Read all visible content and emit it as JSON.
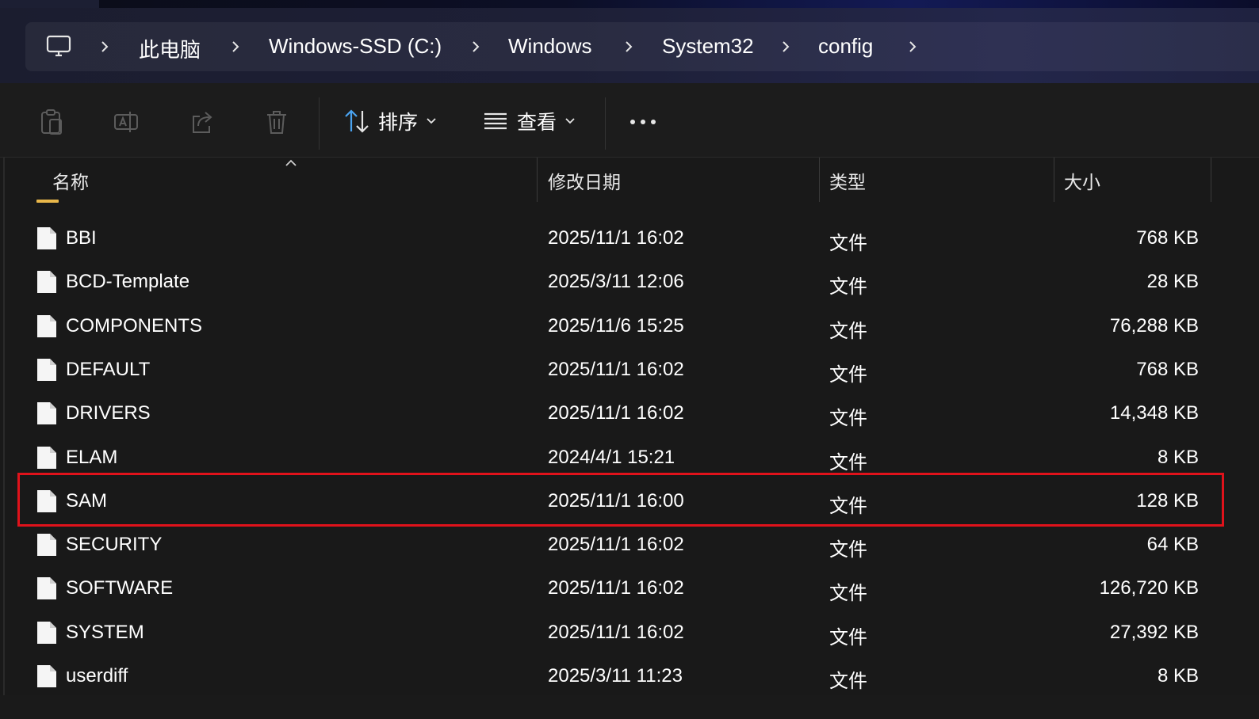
{
  "breadcrumb": {
    "items": [
      "此电脑",
      "Windows-SSD (C:)",
      "Windows",
      "System32",
      "config"
    ]
  },
  "toolbar": {
    "sort_label": "排序",
    "view_label": "查看",
    "icons": [
      "paste-icon",
      "rename-icon",
      "share-icon",
      "delete-icon",
      "sort-icon",
      "view-icon",
      "more-icon"
    ]
  },
  "columns": {
    "name": "名称",
    "date": "修改日期",
    "type": "类型",
    "size": "大小"
  },
  "files": [
    {
      "name": "BBI",
      "date": "2025/11/1 16:02",
      "type": "文件",
      "size": "768 KB"
    },
    {
      "name": "BCD-Template",
      "date": "2025/3/11 12:06",
      "type": "文件",
      "size": "28 KB"
    },
    {
      "name": "COMPONENTS",
      "date": "2025/11/6 15:25",
      "type": "文件",
      "size": "76,288 KB"
    },
    {
      "name": "DEFAULT",
      "date": "2025/11/1 16:02",
      "type": "文件",
      "size": "768 KB"
    },
    {
      "name": "DRIVERS",
      "date": "2025/11/1 16:02",
      "type": "文件",
      "size": "14,348 KB"
    },
    {
      "name": "ELAM",
      "date": "2024/4/1 15:21",
      "type": "文件",
      "size": "8 KB"
    },
    {
      "name": "SAM",
      "date": "2025/11/1 16:00",
      "type": "文件",
      "size": "128 KB"
    },
    {
      "name": "SECURITY",
      "date": "2025/11/1 16:02",
      "type": "文件",
      "size": "64 KB"
    },
    {
      "name": "SOFTWARE",
      "date": "2025/11/1 16:02",
      "type": "文件",
      "size": "126,720 KB"
    },
    {
      "name": "SYSTEM",
      "date": "2025/11/1 16:02",
      "type": "文件",
      "size": "27,392 KB"
    },
    {
      "name": "userdiff",
      "date": "2025/3/11 11:23",
      "type": "文件",
      "size": "8 KB"
    }
  ],
  "highlighted_file": "SAM",
  "colors": {
    "highlight_border": "#e0121b",
    "folder": "#e9b74a",
    "background": "#191919"
  }
}
